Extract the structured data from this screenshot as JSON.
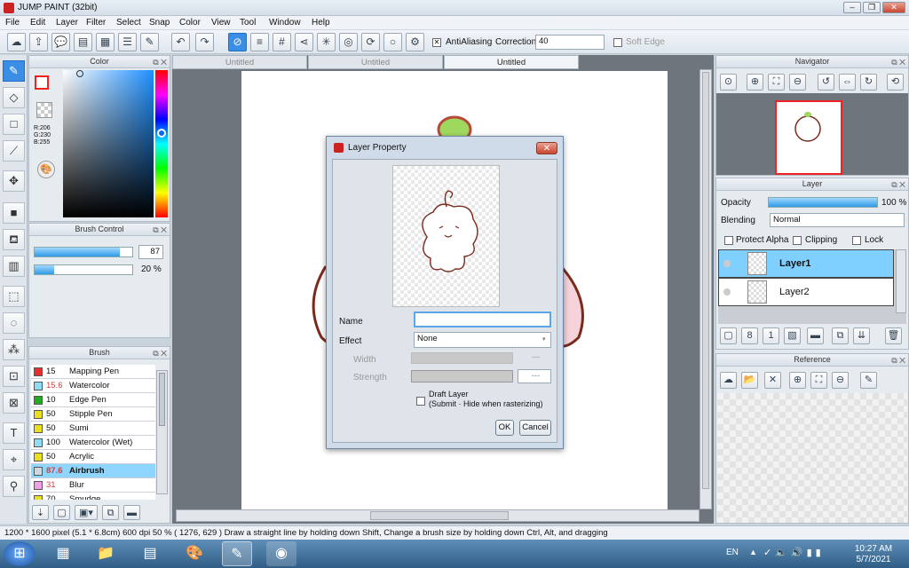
{
  "window": {
    "title": "JUMP PAINT (32bit)"
  },
  "menu": [
    "File",
    "Edit",
    "Layer",
    "Filter",
    "Select",
    "Snap",
    "Color",
    "View",
    "Tool",
    "Window",
    "Help"
  ],
  "toolbar": {
    "antialiasing_label": "AntiAliasing",
    "correction_label": "Correction",
    "correction_value": "40",
    "soft_edge_label": "Soft Edge"
  },
  "color_panel": {
    "title": "Color",
    "r": "R:206",
    "g": "G:230",
    "b": "B:255"
  },
  "brush_control": {
    "title": "Brush Control",
    "size": "87",
    "opacity": "20 %",
    "size_fill": 0.87,
    "opacity_fill": 0.2
  },
  "brush_panel": {
    "title": "Brush",
    "items": [
      {
        "size": "15",
        "name": "Mapping Pen",
        "color": "#e53030",
        "size_color": "#111"
      },
      {
        "size": "15.6",
        "name": "Watercolor",
        "color": "#8fdcf5",
        "size_color": "#d04040"
      },
      {
        "size": "10",
        "name": "Edge Pen",
        "color": "#22aa22",
        "size_color": "#111"
      },
      {
        "size": "50",
        "name": "Stipple Pen",
        "color": "#e8e020",
        "size_color": "#111"
      },
      {
        "size": "50",
        "name": "Sumi",
        "color": "#e8e020",
        "size_color": "#111"
      },
      {
        "size": "100",
        "name": "Watercolor (Wet)",
        "color": "#8fdcf5",
        "size_color": "#111"
      },
      {
        "size": "50",
        "name": "Acrylic",
        "color": "#e8e020",
        "size_color": "#111"
      },
      {
        "size": "87.6",
        "name": "Airbrush",
        "color": "#cfd8e0",
        "size_color": "#d04040",
        "selected": true
      },
      {
        "size": "31",
        "name": "Blur",
        "color": "#f0a0e8",
        "size_color": "#d04040"
      },
      {
        "size": "70",
        "name": "Smudge",
        "color": "#e8e020",
        "size_color": "#111"
      }
    ]
  },
  "tabs": [
    "Untitled",
    "Untitled",
    "Untitled"
  ],
  "navigator": {
    "title": "Navigator"
  },
  "layer_panel": {
    "title": "Layer",
    "opacity_label": "Opacity",
    "opacity_value": "100 %",
    "opacity_fill": 1.0,
    "blending_label": "Blending",
    "blending_value": "Normal",
    "protect_alpha": "Protect Alpha",
    "clipping": "Clipping",
    "lock": "Lock",
    "layers": [
      "Layer1",
      "Layer2"
    ]
  },
  "reference": {
    "title": "Reference"
  },
  "dialog": {
    "title": "Layer Property",
    "name_label": "Name",
    "name_value": "",
    "effect_label": "Effect",
    "effect_value": "None",
    "width_label": "Width",
    "strength_label": "Strength",
    "strength_value": "---",
    "width_value": "---",
    "draft_label": "Draft Layer",
    "draft_sub": "(Submit · Hide when rasterizing)",
    "ok": "OK",
    "cancel": "Cancel"
  },
  "status": {
    "text": "1200 * 1600 pixel   (5.1 * 6.8cm)  600 dpi  50 %   ( 1276, 629 )   Draw a straight line by holding down Shift, Change a brush size by holding down Ctrl, Alt, and dragging"
  },
  "taskbar": {
    "lang": "EN",
    "time": "10:27 AM",
    "date": "5/7/2021"
  }
}
